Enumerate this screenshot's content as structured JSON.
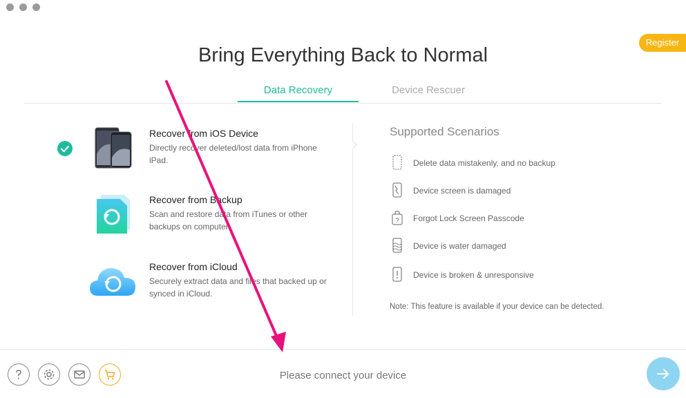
{
  "window": {
    "controls": [
      "close",
      "minimize",
      "zoom"
    ]
  },
  "header": {
    "register_label": "Register",
    "title": "Bring Everything Back to Normal"
  },
  "tabs": [
    {
      "label": "Data Recovery",
      "active": true
    },
    {
      "label": "Device Rescuer",
      "active": false
    }
  ],
  "options": [
    {
      "title": "Recover from iOS Device",
      "desc": "Directly recover deleted/lost data from iPhone iPad.",
      "selected": true,
      "icon": "ios-device-icon"
    },
    {
      "title": "Recover from Backup",
      "desc": "Scan and restore data from iTunes or other backups on computer.",
      "selected": false,
      "icon": "backup-icon"
    },
    {
      "title": "Recover from iCloud",
      "desc": "Securely extract data and files that backed up or synced in iCloud.",
      "selected": false,
      "icon": "icloud-icon"
    }
  ],
  "scenarios": {
    "heading": "Supported Scenarios",
    "items": [
      {
        "label": "Delete data mistakenly, and no backup",
        "icon": "deleted-data-icon"
      },
      {
        "label": "Device screen is damaged",
        "icon": "broken-screen-icon"
      },
      {
        "label": "Forgot Lock Screen Passcode",
        "icon": "locked-device-icon"
      },
      {
        "label": "Device is water damaged",
        "icon": "water-damage-icon"
      },
      {
        "label": "Device is broken & unresponsive",
        "icon": "unresponsive-device-icon"
      }
    ],
    "note": "Note: This feature is available if your device can be detected."
  },
  "footer": {
    "status": "Please connect your device",
    "buttons": [
      "help-icon",
      "settings-icon",
      "mail-icon",
      "cart-icon"
    ]
  },
  "colors": {
    "accent": "#1fbc9c",
    "register": "#f8b613",
    "next_button": "#8ed5f2",
    "annotation_arrow": "#e8137a"
  }
}
